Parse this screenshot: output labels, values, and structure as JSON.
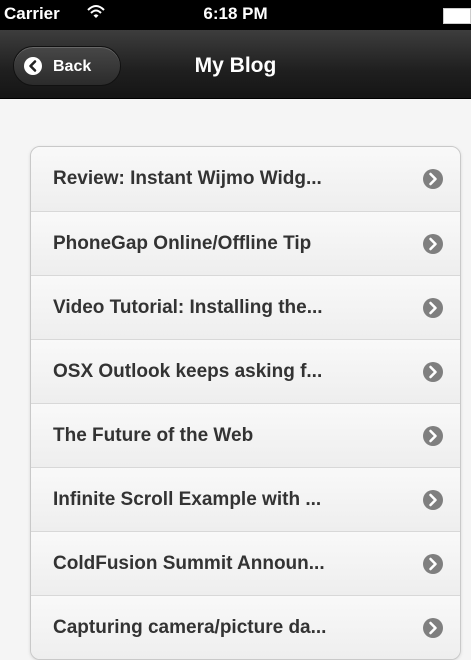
{
  "status_bar": {
    "carrier": "Carrier",
    "time": "6:18 PM",
    "icons": [
      "wifi-icon",
      "battery-icon"
    ]
  },
  "nav": {
    "back_label": "Back",
    "title": "My Blog"
  },
  "posts": [
    {
      "title": "Review: Instant Wijmo Widg..."
    },
    {
      "title": "PhoneGap Online/Offline Tip"
    },
    {
      "title": "Video Tutorial: Installing the..."
    },
    {
      "title": "OSX Outlook keeps asking f..."
    },
    {
      "title": "The Future of the Web"
    },
    {
      "title": "Infinite Scroll Example with ..."
    },
    {
      "title": "ColdFusion Summit Announ..."
    },
    {
      "title": "Capturing camera/picture da..."
    }
  ],
  "colors": {
    "nav_bar": "#1f1f1f",
    "list_background": "#f2f2f2",
    "item_text": "#333333",
    "arrow": "#7f7f7f"
  }
}
